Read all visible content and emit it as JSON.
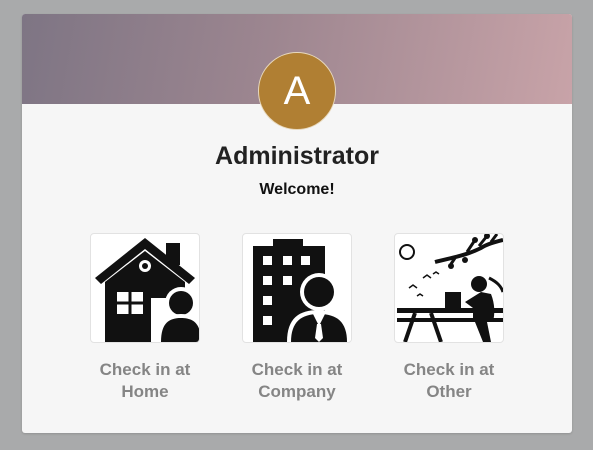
{
  "profile": {
    "avatar_letter": "A",
    "name": "Administrator",
    "greeting": "Welcome!",
    "avatar_color": "#b07f33"
  },
  "options": [
    {
      "label_line1": "Check in at",
      "label_line2": "Home",
      "icon": "home-icon"
    },
    {
      "label_line1": "Check in at",
      "label_line2": "Company",
      "icon": "office-building-icon"
    },
    {
      "label_line1": "Check in at",
      "label_line2": "Other",
      "icon": "outdoor-work-icon"
    }
  ]
}
